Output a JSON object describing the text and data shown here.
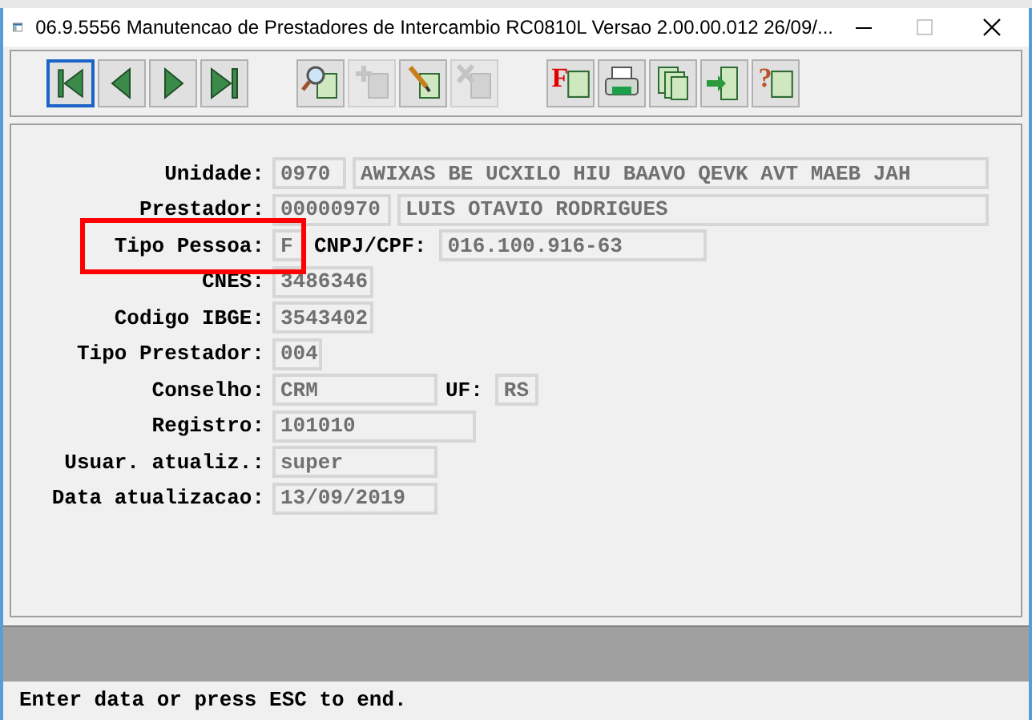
{
  "window": {
    "title": "06.9.5556 Manutencao de Prestadores de Intercambio RC0810L Versao 2.00.00.012 26/09/...",
    "maximize_disabled": true
  },
  "toolbar": [
    [
      {
        "kind": "first",
        "disabled": false,
        "focused": true
      },
      {
        "kind": "prev",
        "disabled": false,
        "focused": false
      },
      {
        "kind": "next",
        "disabled": false,
        "focused": false
      },
      {
        "kind": "last",
        "disabled": false,
        "focused": false
      }
    ],
    [
      {
        "kind": "search",
        "disabled": false,
        "focused": false
      },
      {
        "kind": "add",
        "disabled": true,
        "focused": false
      },
      {
        "kind": "edit",
        "disabled": false,
        "focused": false
      },
      {
        "kind": "delete",
        "disabled": true,
        "focused": false
      }
    ],
    [
      {
        "kind": "report",
        "disabled": false,
        "focused": false,
        "glyph": "F"
      },
      {
        "kind": "print",
        "disabled": false,
        "focused": false
      },
      {
        "kind": "copy",
        "disabled": false,
        "focused": false
      },
      {
        "kind": "exit",
        "disabled": false,
        "focused": false
      },
      {
        "kind": "help",
        "disabled": false,
        "focused": false,
        "glyph": "?"
      }
    ]
  ],
  "form": [
    {
      "label": "Unidade:",
      "highlighted": false,
      "items": [
        {
          "kind": "field",
          "value": "0970"
        },
        {
          "kind": "field",
          "value": "AWIXAS BE UCXILO HIU BAAVO QEVK AVT MAEB JAH"
        }
      ]
    },
    {
      "label": "Prestador:",
      "highlighted": false,
      "items": [
        {
          "kind": "field",
          "value": "00000970"
        },
        {
          "kind": "field",
          "value": "LUIS OTAVIO RODRIGUES"
        }
      ]
    },
    {
      "label": "Tipo Pessoa:",
      "highlighted": true,
      "items": [
        {
          "kind": "field",
          "value": "F"
        },
        {
          "kind": "label",
          "text": "CNPJ/CPF:"
        },
        {
          "kind": "field",
          "value": "016.100.916-63"
        }
      ]
    },
    {
      "label": "CNES:",
      "highlighted": false,
      "items": [
        {
          "kind": "field",
          "value": "3486346"
        }
      ]
    },
    {
      "label": "Codigo IBGE:",
      "highlighted": false,
      "items": [
        {
          "kind": "field",
          "value": "3543402"
        }
      ]
    },
    {
      "label": "Tipo Prestador:",
      "highlighted": false,
      "items": [
        {
          "kind": "field",
          "value": "004"
        }
      ]
    },
    {
      "label": "Conselho:",
      "highlighted": false,
      "items": [
        {
          "kind": "field",
          "value": "CRM"
        },
        {
          "kind": "label",
          "text": "UF:"
        },
        {
          "kind": "field",
          "value": "RS"
        }
      ]
    },
    {
      "label": "Registro:",
      "highlighted": false,
      "items": [
        {
          "kind": "field",
          "value": "101010"
        }
      ]
    },
    {
      "label": "Usuar. atualiz.:",
      "highlighted": false,
      "items": [
        {
          "kind": "field",
          "value": "super"
        }
      ]
    },
    {
      "label": "Data atualizacao:",
      "highlighted": false,
      "items": [
        {
          "kind": "field",
          "value": "13/09/2019"
        }
      ]
    }
  ],
  "status_bar": "Enter data or press ESC to end."
}
